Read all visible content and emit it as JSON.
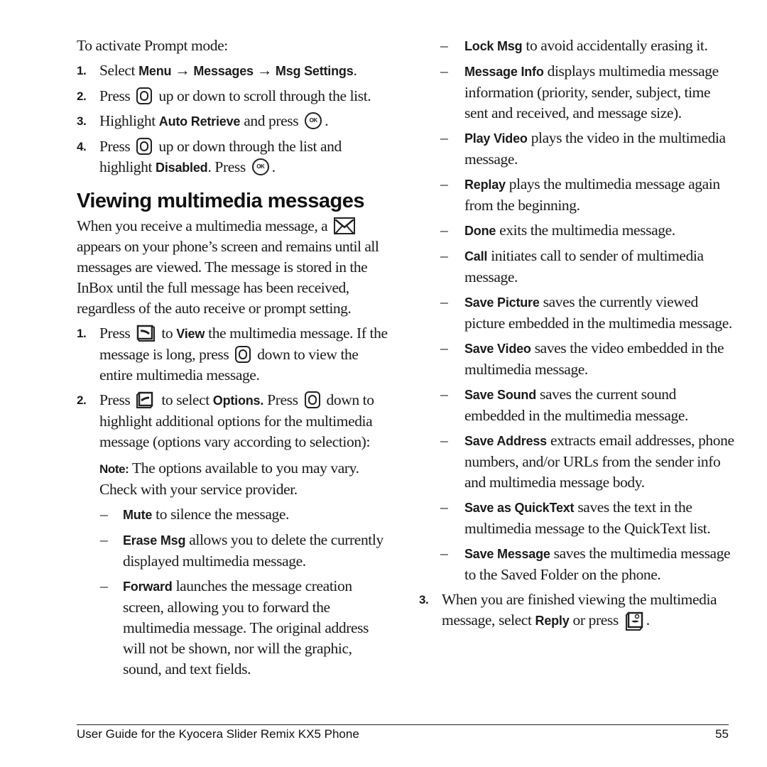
{
  "left": {
    "intro": "To activate Prompt mode:",
    "prompt_steps": [
      {
        "num": "1.",
        "pre": "Select ",
        "b1": "Menu",
        "arrow1": " → ",
        "b2": "Messages",
        "arrow2": " → ",
        "b3": "Msg Settings",
        "post": "."
      },
      {
        "num": "2.",
        "pre": "Press ",
        "icon": "navigation-key-icon",
        "post": " up or down to scroll through the list."
      },
      {
        "num": "3.",
        "pre": "Highlight ",
        "bold": "Auto Retrieve",
        "mid": " and press ",
        "icon": "ok-key-icon",
        "post": "."
      },
      {
        "num": "4.",
        "pre": "Press ",
        "icon": "navigation-key-icon",
        "mid": " up or down through the list and highlight ",
        "bold": "Disabled",
        "mid2": ". Press ",
        "icon2": "ok-key-icon",
        "post": "."
      }
    ],
    "heading": "Viewing multimedia messages",
    "para_pre": "When you receive a multimedia message, a ",
    "para_icon": "envelope-icon",
    "para_post": " appears on your phone’s screen and remains until all messages are viewed. The message is stored in the InBox until the full message has been received, regardless of the auto receive or prompt setting.",
    "view_steps": [
      {
        "num": "1.",
        "pre": "Press ",
        "icon": "right-softkey-icon",
        "mid": " to ",
        "bold": "View",
        "mid2": " the multimedia message. If the message is long, press ",
        "icon2": "navigation-key-icon",
        "post": " down to view the entire multimedia message."
      },
      {
        "num": "2.",
        "pre": "Press ",
        "icon": "left-softkey-icon",
        "mid": " to select ",
        "bold": "Options.",
        "mid2": " Press ",
        "icon2": "navigation-key-icon",
        "post": " down to highlight additional options for the multimedia message (options vary according to selection):"
      }
    ],
    "note_label": "Note:",
    "note_text": " The options available to you may vary. Check with your service provider.",
    "options": [
      {
        "dash": "–",
        "name": "Mute",
        "desc": " to silence the message."
      },
      {
        "dash": "–",
        "name": "Erase Msg",
        "desc": " allows you to delete the currently displayed multimedia message."
      },
      {
        "dash": "–",
        "name": "Forward",
        "desc": " launches the message creation screen, allowing you to forward the multimedia message. The original address will not be shown, nor will the graphic, sound, and text fields."
      }
    ]
  },
  "right": {
    "options": [
      {
        "dash": "–",
        "name": "Lock Msg",
        "desc": " to avoid accidentally erasing it."
      },
      {
        "dash": "–",
        "name": "Message Info",
        "desc": " displays multimedia message information (priority, sender, subject, time sent and received, and message size)."
      },
      {
        "dash": "–",
        "name": "Play Video",
        "desc": " plays the video in the multimedia message."
      },
      {
        "dash": "–",
        "name": "Replay",
        "desc": " plays the multimedia message again from the beginning."
      },
      {
        "dash": "–",
        "name": "Done",
        "desc": " exits the multimedia message."
      },
      {
        "dash": "–",
        "name": "Call",
        "desc": " initiates call to sender of multimedia message."
      },
      {
        "dash": "–",
        "name": "Save Picture",
        "desc": " saves the currently viewed picture embedded in the multimedia message."
      },
      {
        "dash": "–",
        "name": "Save Video",
        "desc": " saves the video embedded in the multimedia message."
      },
      {
        "dash": "–",
        "name": "Save Sound",
        "desc": " saves the current sound embedded in the multimedia message."
      },
      {
        "dash": "–",
        "name": "Save Address",
        "desc": " extracts email addresses, phone numbers, and/or URLs from the sender info and multimedia message body."
      },
      {
        "dash": "–",
        "name": "Save as QuickText",
        "desc": " saves the text in the multimedia message to the QuickText list."
      },
      {
        "dash": "–",
        "name": "Save Message",
        "desc": " saves the multimedia message to the Saved Folder on the phone."
      }
    ],
    "final_step": {
      "num": "3.",
      "pre": "When you are finished viewing the multimedia message, select ",
      "bold": "Reply",
      "mid": " or press ",
      "icon": "speakerphone-key-icon",
      "post": "."
    }
  },
  "footer": {
    "title": "User Guide for the Kyocera Slider Remix KX5 Phone",
    "page": "55"
  },
  "ok_label": "OK"
}
